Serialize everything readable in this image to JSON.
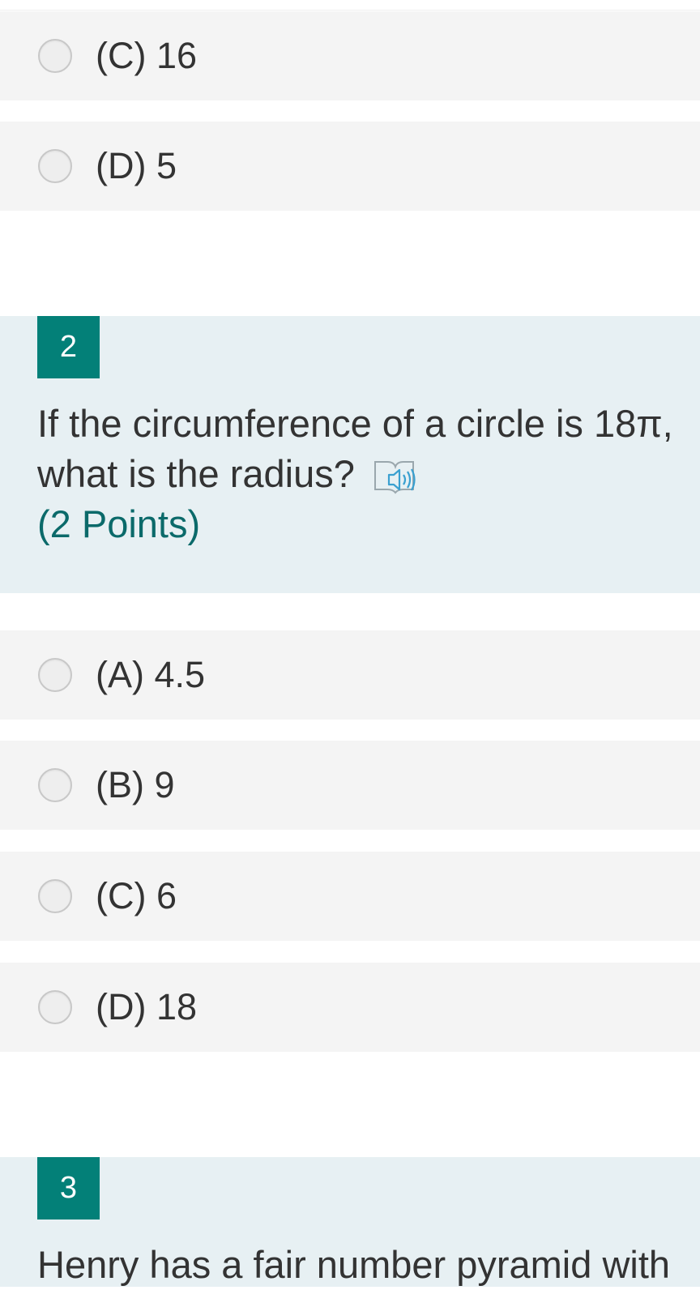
{
  "q1": {
    "options": [
      {
        "label": "(C) 16"
      },
      {
        "label": "(D) 5"
      }
    ]
  },
  "q2": {
    "number": "2",
    "text_line1": "If the circumference of a circle is 18π,",
    "text_line2": "what is the radius?",
    "points": "(2 Points)",
    "options": [
      {
        "label": "(A) 4.5"
      },
      {
        "label": "(B) 9"
      },
      {
        "label": "(C) 6"
      },
      {
        "label": "(D) 18"
      }
    ]
  },
  "q3": {
    "number": "3",
    "text_line1": "Henry has a fair number pyramid with"
  },
  "colors": {
    "accent": "#038078",
    "question_bg": "#e7f0f3",
    "option_bg": "#f4f4f4",
    "points_text": "#0b6a6a",
    "speaker_icon": "#3aa0d0"
  },
  "icons": {
    "radio": "radio-circle",
    "speaker": "immersive-reader-speaker-icon"
  }
}
